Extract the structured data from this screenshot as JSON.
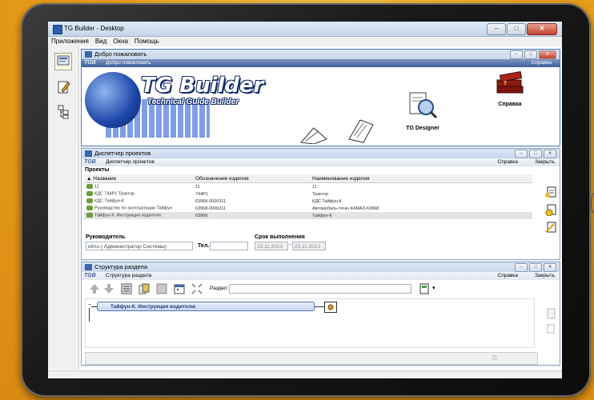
{
  "window": {
    "title": "TG Builder - Desktop",
    "min": "–",
    "max": "□",
    "close": "✕"
  },
  "menu": [
    "Приложения",
    "Вид",
    "Окна",
    "Помощь"
  ],
  "welcome": {
    "title": "Добро пожаловать",
    "tg_logo": "TGB",
    "tab_title": "Добро пожаловать",
    "help": "Справка",
    "brand": "TG Builder",
    "brand_sub": "Technical Guide Builder",
    "items": {
      "help_label": "Справка",
      "designer_label": "TG Designer"
    }
  },
  "projects": {
    "title": "Диспетчер проектов",
    "tg_logo": "TGB",
    "tab_title": "Диспетчер проектов",
    "help": "Справка",
    "close": "Закрыть",
    "section": "Проекты",
    "columns": [
      "Название",
      "Обозначение изделия",
      "Наименование изделия"
    ],
    "rows": [
      [
        "11",
        "11",
        "11"
      ],
      [
        "КДС 744Р1 Трактор",
        "744Р1",
        "Трактор"
      ],
      [
        "КДС Тайфун-К",
        "63968-0000311",
        "КДС Тайфун-К"
      ],
      [
        "Руководство по эксплуатации Тайфун",
        "63968-0000311",
        "Автомобиль-тягач КАМАЗ-63968"
      ],
      [
        "Тайфун-К. Инструкция водителю",
        "63968",
        "Тайфун-К"
      ]
    ],
    "manager_label": "Руководитель",
    "manager_value": "elmu ( Администратор Системы)",
    "phone_label": "Тел.",
    "phone_value": "",
    "deadline_label": "Срок выполнения",
    "date_from": "23.11.2013",
    "date_sep": "-",
    "date_to": "23.11.2013"
  },
  "structure": {
    "title": "Структура раздела",
    "tg_logo": "TGB",
    "tab_title": "Структура раздела",
    "help": "Справка",
    "close": "Закрыть",
    "section_label": "Раздел:",
    "section_value": "",
    "node": "Тайфун-К. Инструкция водителю"
  },
  "colors": {
    "accent": "#2b5fd8",
    "titlebar": "#c9d8ec",
    "tgbar": "#3e5f9c"
  }
}
